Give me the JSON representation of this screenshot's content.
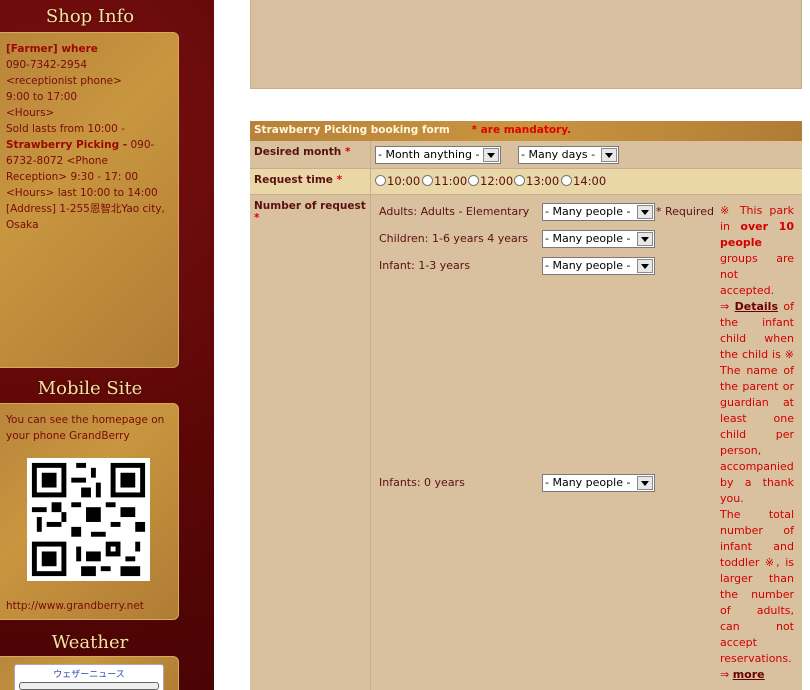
{
  "sidebar": {
    "shop_title": "Shop Info",
    "shop": {
      "farmer": "[Farmer] where",
      "phone1": "090-7342-2954",
      "phone_label": "<receptionist phone>",
      "hours1": "9:00 to 17:00",
      "hours_label": "<Hours>",
      "sold": "Sold lasts from 10:00 -",
      "picking": "Strawberry Picking -",
      "phone2": "090-6732-8072",
      "phone_recep": "<Phone Reception>",
      "hours2": "9:30 - 17: 00 <Hours> last 10:00 to 14:00 [Address] 1-255恩智北Yao city, Osaka"
    },
    "mobile_title": "Mobile Site",
    "mobile_text": "You can see the homepage on your phone GrandBerry",
    "mobile_url": "http://www.grandberry.net",
    "weather_title": "Weather",
    "weather_widget": "ウェザーニュース"
  },
  "form": {
    "title": "Strawberry Picking booking form",
    "mandatory_note": "* are mandatory.",
    "req_mark": "*",
    "month_label": "Desired month",
    "month_select": "- Month anything -",
    "days_select": "- Many days -",
    "time_label": "Request time",
    "times": [
      "10:00",
      "11:00",
      "12:00",
      "13:00",
      "14:00"
    ],
    "people_label": "Number of request",
    "people_rows": [
      {
        "label": "Adults: Adults - Elementary",
        "select": "- Many people -"
      },
      {
        "label": "Children: 1-6 years 4 years",
        "select": "- Many people -"
      },
      {
        "label": "Infant: 1-3 years",
        "select": "- Many people -"
      },
      {
        "label": "Infants: 0 years",
        "select": "- Many people -"
      }
    ],
    "required_text": "* Required",
    "notes": {
      "p1a": "※ This park in ",
      "p1b": "over 10 people",
      "p1c": " groups are not accepted.",
      "arrow1": "⇒ ",
      "details": "Details",
      "p2": " of the infant child when the child is ※ The name of the parent or guardian at least one child per person, accompanied by a thank you.",
      "p3": "The total number of infant and toddler ※, is larger than the number of adults, can not accept reservations.",
      "arrow2": "⇒ ",
      "more": "more"
    }
  }
}
